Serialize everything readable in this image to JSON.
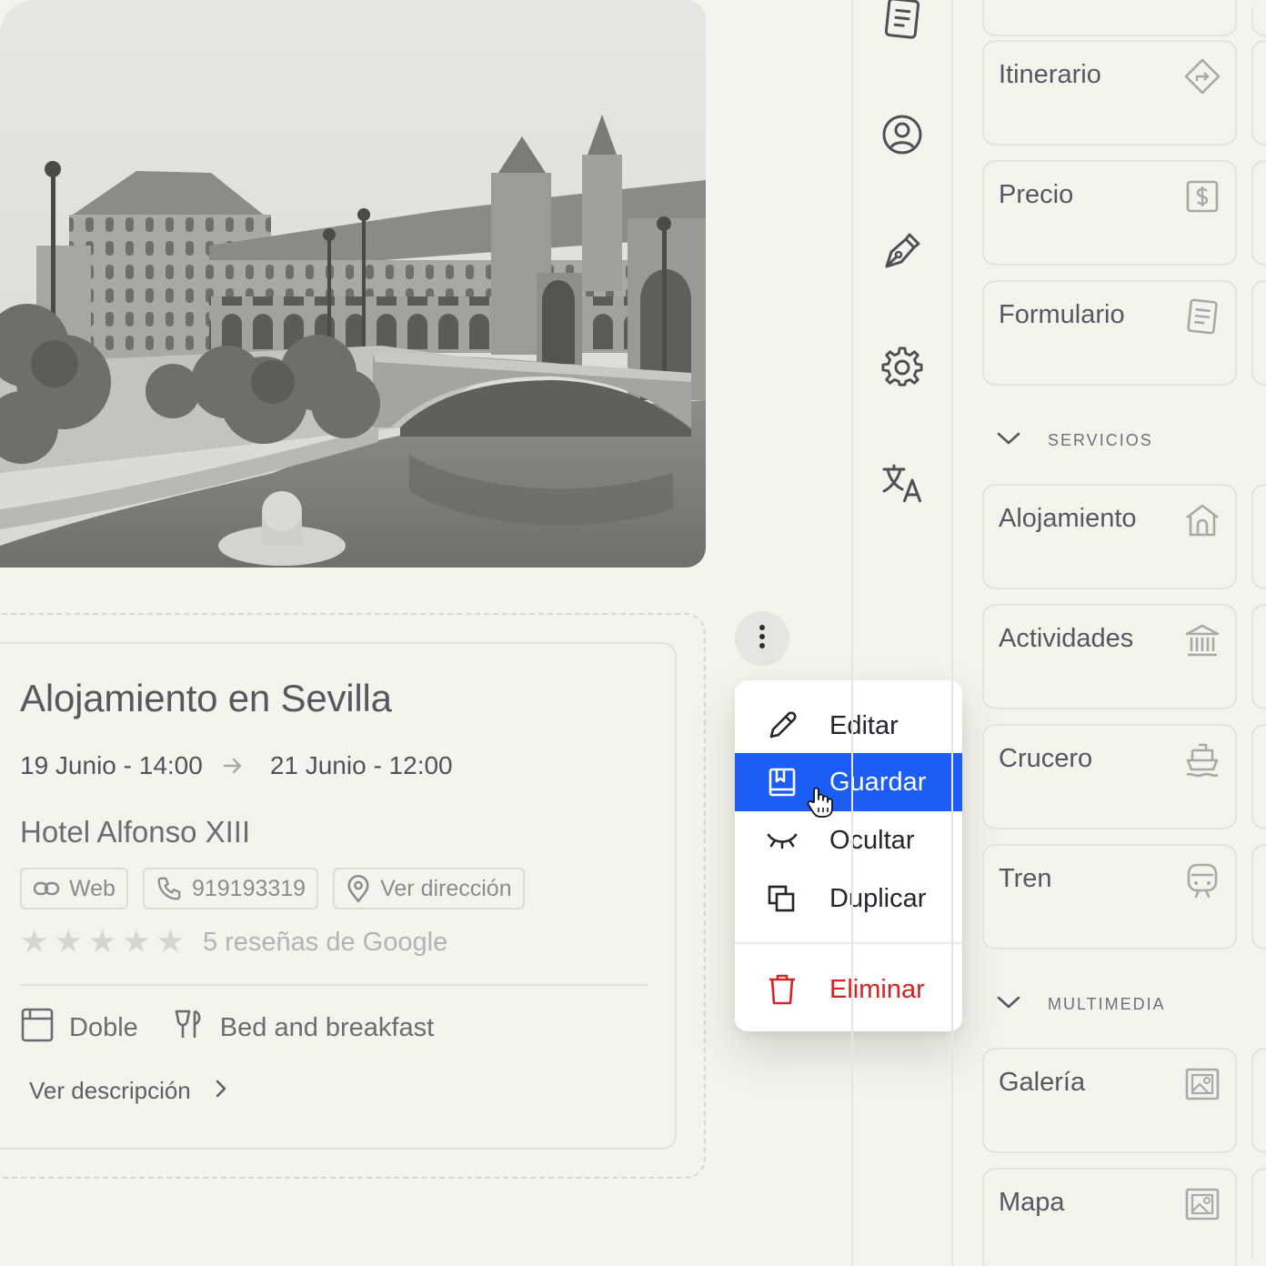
{
  "photo": {
    "alt_name": "plaza-de-espana-photo"
  },
  "card": {
    "title": "Alojamiento en Sevilla",
    "start": "19 Junio - 14:00",
    "end": "21 Junio - 12:00",
    "hotel": "Hotel Alfonso XIII",
    "chips": {
      "web": "Web",
      "phone": "919193319",
      "address": "Ver dirección"
    },
    "rating": {
      "stars": 0,
      "max": 5,
      "reviews": "5 reseñas de Google"
    },
    "room": "Doble",
    "board": "Bed and breakfast",
    "description_link": "Ver descripción"
  },
  "menu": {
    "edit": "Editar",
    "save": "Guardar",
    "hide": "Ocultar",
    "duplicate": "Duplicar",
    "delete": "Eliminar",
    "active_item": "save"
  },
  "rail": [
    "document-icon",
    "profile-icon",
    "pen-nib-icon",
    "gear-icon",
    "translate-icon"
  ],
  "panel": {
    "blocks_top": [
      {
        "label": "Itinerario",
        "icon": "route-icon"
      },
      {
        "label": "Precio",
        "icon": "dollar-icon"
      },
      {
        "label": "Formulario",
        "icon": "form-icon"
      }
    ],
    "section_services": "SERVICIOS",
    "services": [
      {
        "label": "Alojamiento",
        "icon": "house-icon"
      },
      {
        "label": "Actividades",
        "icon": "museum-icon"
      },
      {
        "label": "Crucero",
        "icon": "ship-icon"
      },
      {
        "label": "Tren",
        "icon": "train-icon"
      }
    ],
    "section_multimedia": "MULTIMEDIA",
    "multimedia": [
      {
        "label": "Galería",
        "icon": "gallery-icon"
      },
      {
        "label": "Mapa",
        "icon": "gallery-icon"
      }
    ]
  },
  "colors": {
    "background": "#f4f3ec",
    "accent": "#1b5df5",
    "danger": "#d62222"
  }
}
